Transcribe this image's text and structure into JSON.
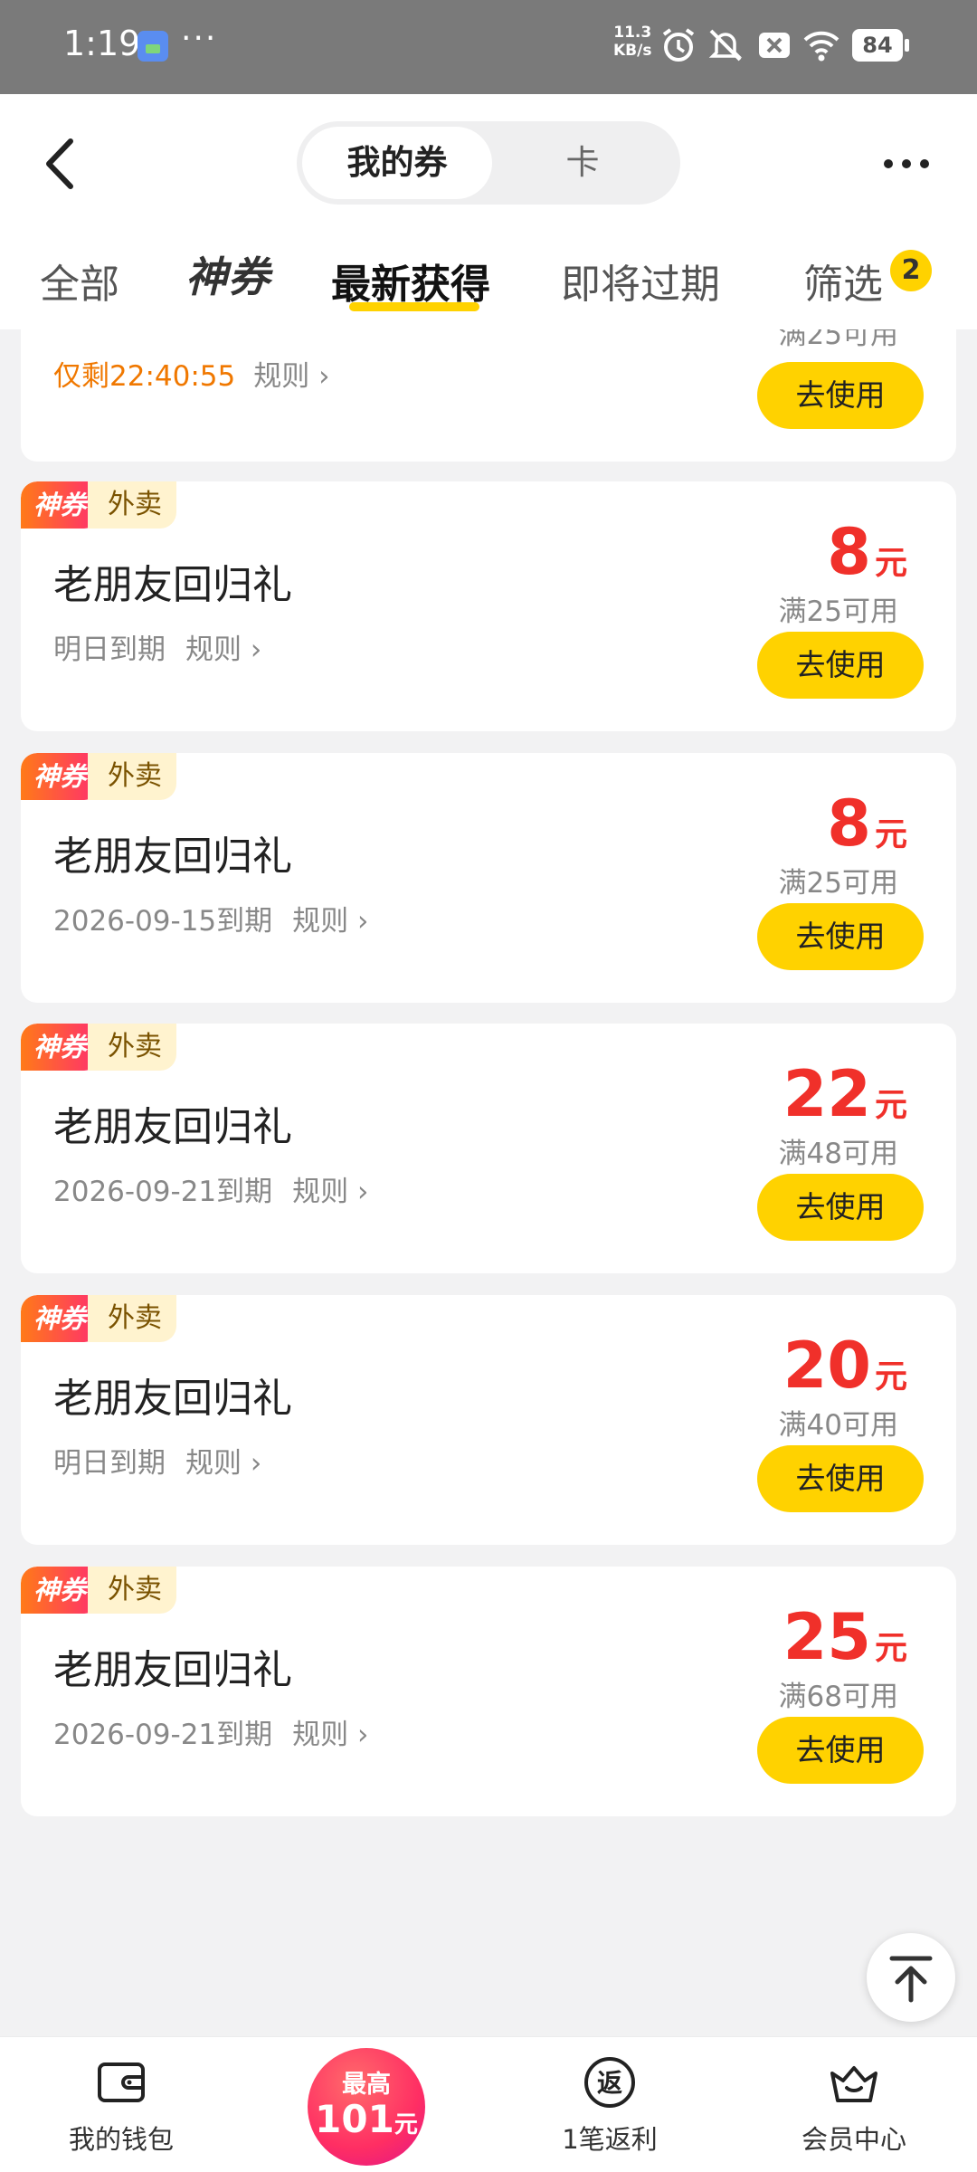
{
  "status_bar": {
    "time": "1:19",
    "dots": "···",
    "speed_top": "11.3",
    "speed_unit": "KB/s",
    "battery": "84"
  },
  "header": {
    "seg_active": "我的券",
    "seg_inactive": "卡"
  },
  "tabs": [
    {
      "label": "全部"
    },
    {
      "label": "神券"
    },
    {
      "label": "最新获得"
    },
    {
      "label": "即将过期"
    },
    {
      "label": "筛选"
    }
  ],
  "filter_count": "2",
  "partial_card": {
    "countdown": "仅剩22:40:55",
    "rule": "规则 ›",
    "condition": "满25可用",
    "button": "去使用"
  },
  "coupons": [
    {
      "tag1": "神券",
      "tag2": "外卖",
      "title": "老朋友回归礼",
      "expiry": "明日到期",
      "rule": "规则 ›",
      "amount": "8",
      "unit": "元",
      "condition": "满25可用",
      "button": "去使用"
    },
    {
      "tag1": "神券",
      "tag2": "外卖",
      "title": "老朋友回归礼",
      "expiry": "2026-09-15到期",
      "rule": "规则 ›",
      "amount": "8",
      "unit": "元",
      "condition": "满25可用",
      "button": "去使用"
    },
    {
      "tag1": "神券",
      "tag2": "外卖",
      "title": "老朋友回归礼",
      "expiry": "2026-09-21到期",
      "rule": "规则 ›",
      "amount": "22",
      "unit": "元",
      "condition": "满48可用",
      "button": "去使用"
    },
    {
      "tag1": "神券",
      "tag2": "外卖",
      "title": "老朋友回归礼",
      "expiry": "明日到期",
      "rule": "规则 ›",
      "amount": "20",
      "unit": "元",
      "condition": "满40可用",
      "button": "去使用"
    },
    {
      "tag1": "神券",
      "tag2": "外卖",
      "title": "老朋友回归礼",
      "expiry": "2026-09-21到期",
      "rule": "规则 ›",
      "amount": "25",
      "unit": "元",
      "condition": "满68可用",
      "button": "去使用"
    }
  ],
  "bottom_nav": {
    "wallet": "我的钱包",
    "promo_top": "最高",
    "promo_amount": "101",
    "promo_unit": "元",
    "rebate": "1笔返利",
    "rebate_icon_char": "返",
    "member": "会员中心"
  },
  "colors": {
    "accent_yellow": "#ffd200",
    "price_red": "#f0302a",
    "countdown_orange": "#f07800"
  }
}
